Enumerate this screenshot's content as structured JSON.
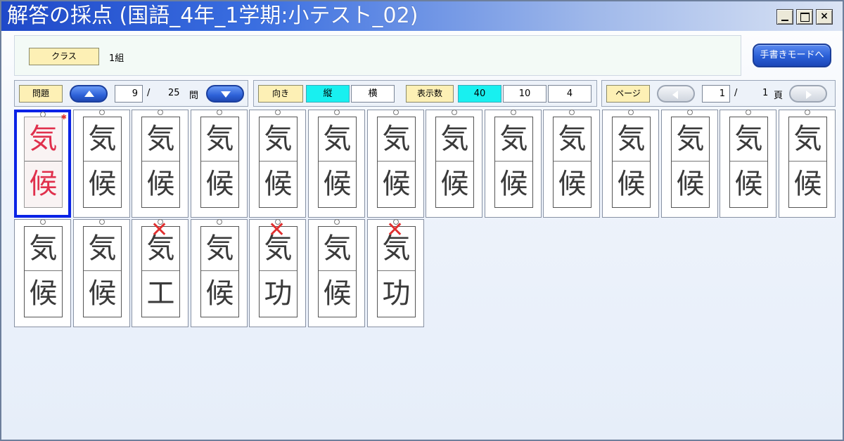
{
  "window": {
    "title": "解答の採点 (国語_4年_1学期:小テスト_02)",
    "controls": {
      "minimize": "_",
      "maximize": "□",
      "close": "×"
    }
  },
  "class_panel": {
    "label": "クラス",
    "value": "1組",
    "handwrite_button": "手書きモードへ"
  },
  "question_nav": {
    "label": "問題",
    "current": "9",
    "separator": "/",
    "total": "25",
    "unit": "問"
  },
  "display": {
    "orientation_label": "向き",
    "orientation_options": [
      "縦",
      "横"
    ],
    "orientation_selected": "縦",
    "count_label": "表示数",
    "count_options": [
      "40",
      "10",
      "4"
    ],
    "count_selected": "40"
  },
  "page_nav": {
    "label": "ページ",
    "current": "1",
    "separator": "/",
    "total": "1",
    "unit": "頁"
  },
  "answers": [
    {
      "top": "気",
      "bottom": "候",
      "selected": true,
      "wrong": false
    },
    {
      "top": "気",
      "bottom": "候",
      "selected": false,
      "wrong": false
    },
    {
      "top": "気",
      "bottom": "候",
      "selected": false,
      "wrong": false
    },
    {
      "top": "気",
      "bottom": "候",
      "selected": false,
      "wrong": false
    },
    {
      "top": "気",
      "bottom": "候",
      "selected": false,
      "wrong": false
    },
    {
      "top": "気",
      "bottom": "候",
      "selected": false,
      "wrong": false
    },
    {
      "top": "気",
      "bottom": "候",
      "selected": false,
      "wrong": false
    },
    {
      "top": "気",
      "bottom": "候",
      "selected": false,
      "wrong": false
    },
    {
      "top": "気",
      "bottom": "候",
      "selected": false,
      "wrong": false
    },
    {
      "top": "気",
      "bottom": "候",
      "selected": false,
      "wrong": false
    },
    {
      "top": "気",
      "bottom": "候",
      "selected": false,
      "wrong": false
    },
    {
      "top": "気",
      "bottom": "候",
      "selected": false,
      "wrong": false
    },
    {
      "top": "気",
      "bottom": "候",
      "selected": false,
      "wrong": false
    },
    {
      "top": "気",
      "bottom": "候",
      "selected": false,
      "wrong": false
    },
    {
      "top": "気",
      "bottom": "候",
      "selected": false,
      "wrong": false
    },
    {
      "top": "気",
      "bottom": "候",
      "selected": false,
      "wrong": false
    },
    {
      "top": "気",
      "bottom": "工",
      "selected": false,
      "wrong": true
    },
    {
      "top": "気",
      "bottom": "候",
      "selected": false,
      "wrong": false
    },
    {
      "top": "気",
      "bottom": "功",
      "selected": false,
      "wrong": true
    },
    {
      "top": "気",
      "bottom": "候",
      "selected": false,
      "wrong": false
    },
    {
      "top": "気",
      "bottom": "功",
      "selected": false,
      "wrong": true
    }
  ],
  "wrong_mark": "✕",
  "colors": {
    "selected_border": "#0a23e6",
    "selected_option": "#18f0f0",
    "label_bg": "#fdf0b5",
    "wrong_mark": "#e03030",
    "correct_mark": "#e0304c"
  }
}
